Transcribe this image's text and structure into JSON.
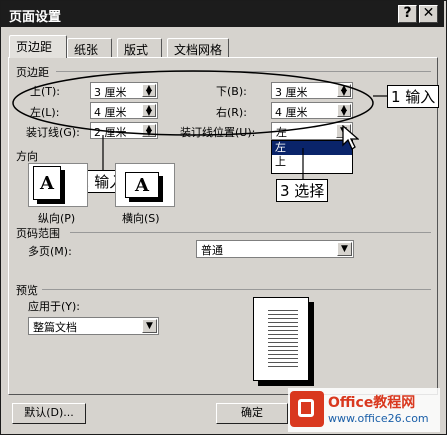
{
  "window": {
    "title": "页面设置",
    "help_label": "?",
    "close_label": "✕"
  },
  "tabs": [
    {
      "label": "页边距"
    },
    {
      "label": "纸张"
    },
    {
      "label": "版式"
    },
    {
      "label": "文档网格"
    }
  ],
  "margins": {
    "section_label": "页边距",
    "top": {
      "label": "上(T):",
      "value": "3 厘米"
    },
    "bottom": {
      "label": "下(B):",
      "value": "3 厘米"
    },
    "left": {
      "label": "左(L):",
      "value": "4 厘米"
    },
    "right": {
      "label": "右(R):",
      "value": "4 厘米"
    },
    "gutter": {
      "label": "装订线(G):",
      "value": "2 厘米"
    },
    "gutter_pos": {
      "label": "装订线位置(U):",
      "value": "左",
      "options": [
        "左",
        "上"
      ]
    }
  },
  "orientation": {
    "section_label": "方向",
    "portrait_label": "纵向(P)",
    "landscape_label": "横向(S)",
    "icon_letter": "A"
  },
  "pages": {
    "section_label": "页码范围",
    "multiple_label": "多页(M):",
    "multiple_value": "普通"
  },
  "preview": {
    "section_label": "预览",
    "apply_label": "应用于(Y):",
    "apply_value": "整篇文档"
  },
  "buttons": {
    "default_label": "默认(D)...",
    "ok_label": "确定"
  },
  "callouts": {
    "c1": "1 输入",
    "c2": "2 输入",
    "c3": "3 选择"
  },
  "watermark": {
    "brand": "Office教程网",
    "url": "www.office26.com"
  },
  "colors": {
    "titlebar": "#1c1c1c",
    "dialog_bg": "#d6d3ce",
    "watermark_red": "#d9381e",
    "watermark_blue": "#1a5fa8"
  }
}
